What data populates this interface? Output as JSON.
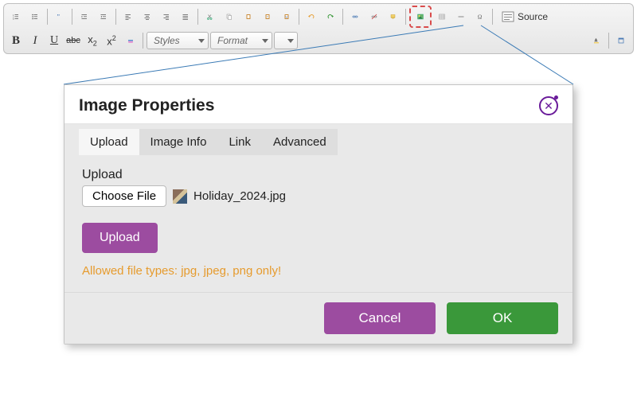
{
  "toolbar": {
    "row1": {
      "source_label": "Source"
    },
    "row2": {
      "bold": "B",
      "italic": "I",
      "underline": "U",
      "strike": "abc",
      "sub": "x",
      "sup": "x",
      "styles_label": "Styles",
      "format_label": "Format"
    }
  },
  "dialog": {
    "title": "Image Properties",
    "tabs": [
      "Upload",
      "Image Info",
      "Link",
      "Advanced"
    ],
    "active_tab": 0,
    "upload": {
      "section_label": "Upload",
      "choose_file_label": "Choose File",
      "file_name": "Holiday_2024.jpg",
      "upload_button": "Upload",
      "allowed_text": "Allowed file types: jpg, jpeg, png only!"
    },
    "footer": {
      "cancel": "Cancel",
      "ok": "OK"
    }
  }
}
